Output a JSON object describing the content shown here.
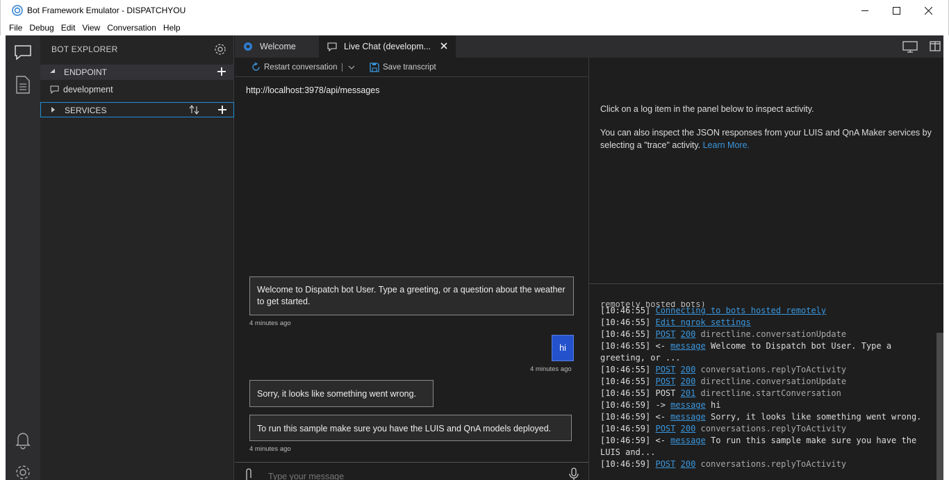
{
  "window": {
    "title": "Bot Framework Emulator - DISPATCHYOU"
  },
  "menu": [
    "File",
    "Debug",
    "Edit",
    "View",
    "Conversation",
    "Help"
  ],
  "explorer": {
    "title": "BOT EXPLORER",
    "endpoint_label": "ENDPOINT",
    "endpoint_item": "development",
    "services_label": "SERVICES"
  },
  "tabs": {
    "welcome": "Welcome",
    "livechat": "Live Chat (developm..."
  },
  "toolbar": {
    "restart": "Restart conversation",
    "save": "Save transcript"
  },
  "chat": {
    "endpoint_url": "http://localhost:3978/api/messages",
    "messages": [
      {
        "text": "Welcome to Dispatch bot User. Type a greeting, or a question about the weather to get started.",
        "time": "4 minutes ago"
      },
      {
        "text": "hi",
        "time": "4 minutes ago"
      },
      {
        "text": "Sorry, it looks like something went wrong."
      },
      {
        "text": "To run this sample make sure you have the LUIS and QnA models deployed.",
        "time": "4 minutes ago"
      }
    ],
    "input_placeholder": "Type your message"
  },
  "inspector": {
    "line1": "Click on a log item in the panel below to inspect activity.",
    "line2": "You can also inspect the JSON responses from your LUIS and QnA Maker services by selecting a \"trace\" activity.",
    "learn_more": "Learn More."
  },
  "log": {
    "partial_line": "remotely hosted bots)",
    "lines": [
      {
        "time": "10:46:55",
        "parts": [
          {
            "link": "Connecting to bots hosted remotely"
          }
        ]
      },
      {
        "time": "10:46:55",
        "parts": [
          {
            "link": "Edit ngrok settings"
          }
        ]
      },
      {
        "time": "10:46:55",
        "parts": [
          {
            "link": "POST"
          },
          {
            "text": " "
          },
          {
            "link": "200"
          },
          {
            "dim": " directline.conversationUpdate"
          }
        ]
      },
      {
        "time": "10:46:55",
        "parts": [
          {
            "text": "<- "
          },
          {
            "link": "message"
          },
          {
            "text": " Welcome to Dispatch bot User. Type a greeting, or ..."
          }
        ]
      },
      {
        "time": "10:46:55",
        "parts": [
          {
            "link": "POST"
          },
          {
            "text": " "
          },
          {
            "link": "200"
          },
          {
            "dim": " conversations.replyToActivity"
          }
        ]
      },
      {
        "time": "10:46:55",
        "parts": [
          {
            "link": "POST"
          },
          {
            "text": " "
          },
          {
            "link": "200"
          },
          {
            "dim": " directline.conversationUpdate"
          }
        ]
      },
      {
        "time": "10:46:55",
        "parts": [
          {
            "text": "POST "
          },
          {
            "link": "201"
          },
          {
            "dim": " directline.startConversation"
          }
        ]
      },
      {
        "time": "10:46:59",
        "parts": [
          {
            "text": "-> "
          },
          {
            "link": "message"
          },
          {
            "text": " hi"
          }
        ]
      },
      {
        "time": "10:46:59",
        "parts": [
          {
            "text": "<- "
          },
          {
            "link": "message"
          },
          {
            "text": " Sorry, it looks like something went wrong."
          }
        ]
      },
      {
        "time": "10:46:59",
        "parts": [
          {
            "link": "POST"
          },
          {
            "text": " "
          },
          {
            "link": "200"
          },
          {
            "dim": " conversations.replyToActivity"
          }
        ]
      },
      {
        "time": "10:46:59",
        "parts": [
          {
            "text": "<- "
          },
          {
            "link": "message"
          },
          {
            "text": " To run this sample make sure you have the LUIS and..."
          }
        ]
      },
      {
        "time": "10:46:59",
        "parts": [
          {
            "link": "POST"
          },
          {
            "text": " "
          },
          {
            "link": "200"
          },
          {
            "dim": " conversations.replyToActivity"
          }
        ]
      }
    ]
  },
  "colors": {
    "accent_blue": "#2352cc",
    "link_blue": "#3a96dd",
    "background": "#1e1e1e",
    "sidebar": "#252526",
    "focus_border": "#1e8fd6"
  }
}
